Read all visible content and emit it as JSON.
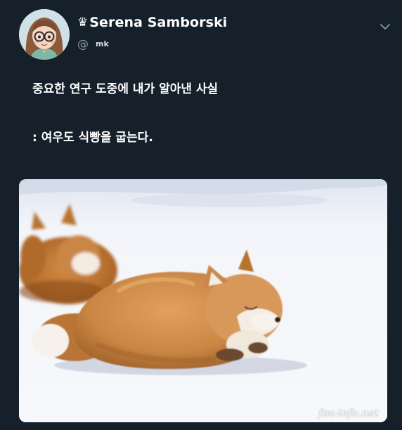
{
  "user": {
    "crown_glyph": "♛",
    "display_name": "Serena Samborski",
    "at_glyph": "@",
    "handle": "mk"
  },
  "tweet": {
    "line1": "중요한 연구 도중에 내가 알아낸 사실",
    "line2": ": 여우도 식빵을 굽는다."
  },
  "media": {
    "watermark": "fox-info.net",
    "subject": "two red foxes resting on snow"
  },
  "icons": {
    "more": "chevron-down-icon",
    "avatar": "cartoon-girl-with-glasses"
  },
  "colors": {
    "background": "#15202b",
    "text": "#ffffff",
    "secondary": "#8899a6"
  }
}
